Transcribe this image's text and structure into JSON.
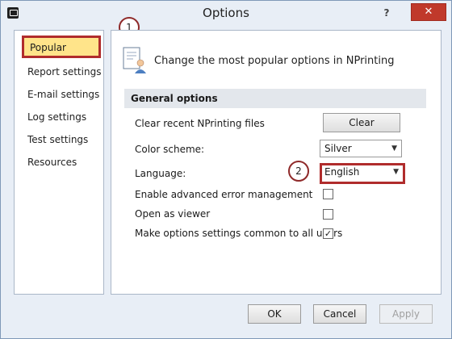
{
  "window": {
    "title": "Options",
    "help_label": "?",
    "close_label": "✕"
  },
  "sidebar": {
    "items": [
      {
        "label": "Popular"
      },
      {
        "label": "Report settings"
      },
      {
        "label": "E-mail settings"
      },
      {
        "label": "Log settings"
      },
      {
        "label": "Test settings"
      },
      {
        "label": "Resources"
      }
    ],
    "selected": "Popular"
  },
  "callouts": {
    "first": "1",
    "second": "2"
  },
  "content": {
    "header_text": "Change the most popular options in NPrinting",
    "group_title": "General options",
    "clear_row": {
      "label": "Clear recent NPrinting files",
      "button_label": "Clear"
    },
    "color_scheme": {
      "label": "Color scheme:",
      "value": "Silver",
      "chevron": "▼"
    },
    "language": {
      "label": "Language:",
      "value": "English",
      "chevron": "▼"
    },
    "checkboxes": [
      {
        "label": "Enable advanced error management",
        "checked": false,
        "mark": ""
      },
      {
        "label": "Open as viewer",
        "checked": false,
        "mark": ""
      },
      {
        "label": "Make options settings common to all users",
        "checked": true,
        "mark": "✓"
      }
    ]
  },
  "footer": {
    "ok_label": "OK",
    "cancel_label": "Cancel",
    "apply_label": "Apply"
  },
  "colors": {
    "highlight_border": "#b02c2c",
    "selected_bg": "#ffe48a",
    "close_bg": "#c0392b"
  }
}
